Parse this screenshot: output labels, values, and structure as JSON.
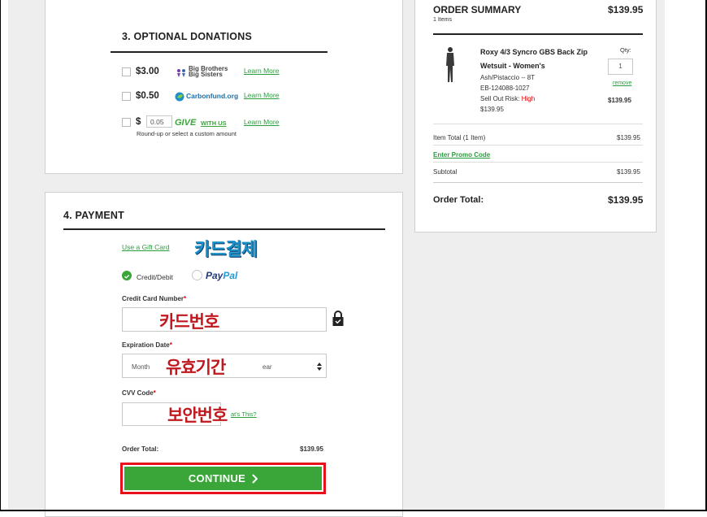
{
  "donations": {
    "title": "3. OPTIONAL DONATIONS",
    "items": [
      {
        "amount": "$3.00",
        "org_line1": "Big Brothers",
        "org_line2": "Big Sisters",
        "learn": "Learn More"
      },
      {
        "amount": "$0.50",
        "org": "Carbonfund.org",
        "learn": "Learn More"
      },
      {
        "amount_prefix": "$",
        "amount_value": "0.05",
        "org": "GIVE",
        "org_suffix": "WITH US",
        "learn": "Learn More"
      }
    ],
    "roundup_note": "Round-up or select a custom amount"
  },
  "payment": {
    "title": "4. PAYMENT",
    "gift_card_link": "Use a Gift Card",
    "annotation_card_payment": "카드결제",
    "methods": {
      "credit": "Credit/Debit",
      "paypal_pay": "Pay",
      "paypal_pal": "Pal"
    },
    "credit_card_label": "Credit Card Number",
    "annotation_card_number": "카드번호",
    "expiration_label": "Expiration Date",
    "month_placeholder": "Month",
    "year_fragment": "ear",
    "annotation_expiration": "유효기간",
    "cvv_label": "CVV Code",
    "annotation_cvv": "보안번호",
    "whats_this_fragment": "at's This?",
    "order_total_label": "Order Total:",
    "order_total_value": "$139.95",
    "continue_label": "CONTINUE",
    "required_mark": "*"
  },
  "summary": {
    "title": "ORDER SUMMARY",
    "title_total": "$139.95",
    "item_count": "1 Items",
    "product": {
      "name_line1": "Roxy 4/3 Syncro GBS Back Zip",
      "name_line2": "Wetsuit - Women's",
      "variant": "Ash/Pistaccio -- 8T",
      "sku": "EB-124088-1027",
      "risk_label": "Sell Out Risk:",
      "risk_value": "High",
      "price": "$139.95",
      "qty_label": "Qty:",
      "qty_value": "1",
      "remove": "remove",
      "line_total": "$139.95"
    },
    "item_total_label": "Item Total (1 Item)",
    "item_total_value": "$139.95",
    "promo_link": "Enter Promo Code",
    "subtotal_label": "Subtotal",
    "subtotal_value": "$139.95",
    "order_total_label": "Order Total:",
    "order_total_value": "$139.95"
  },
  "colors": {
    "accent_green": "#3aa63a",
    "link_green": "#2a9d3f",
    "risk_red": "#d00000",
    "highlight_red": "#e8101a"
  }
}
